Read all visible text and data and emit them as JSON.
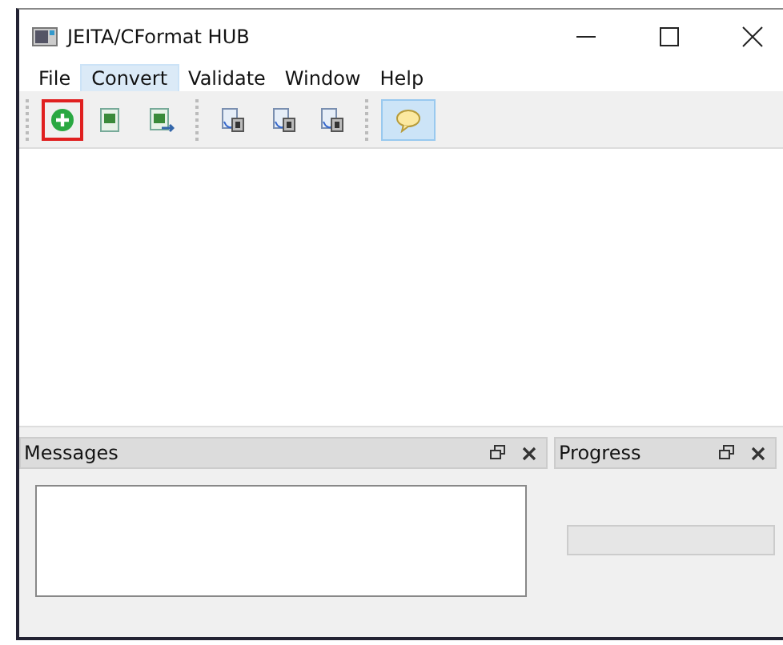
{
  "window": {
    "title": "JEITA/CFormat HUB"
  },
  "menu": [
    {
      "label": "File",
      "selected": false
    },
    {
      "label": "Convert",
      "selected": true
    },
    {
      "label": "Validate",
      "selected": false
    },
    {
      "label": "Window",
      "selected": false
    },
    {
      "label": "Help",
      "selected": false
    }
  ],
  "toolbar": [
    {
      "kind": "add",
      "selected": false,
      "marked": true
    },
    {
      "kind": "sheet",
      "selected": false,
      "marked": false
    },
    {
      "kind": "sheet-export",
      "selected": false,
      "marked": false
    },
    {
      "kind": "doc-c",
      "selected": false,
      "marked": false
    },
    {
      "kind": "doc-si",
      "selected": false,
      "marked": false
    },
    {
      "kind": "doc-hand",
      "selected": false,
      "marked": false
    },
    {
      "kind": "comment",
      "selected": true,
      "marked": false
    }
  ],
  "docks": [
    {
      "title": "Messages",
      "kind": "messages"
    },
    {
      "title": "Progress",
      "kind": "progress",
      "level": 0
    }
  ]
}
